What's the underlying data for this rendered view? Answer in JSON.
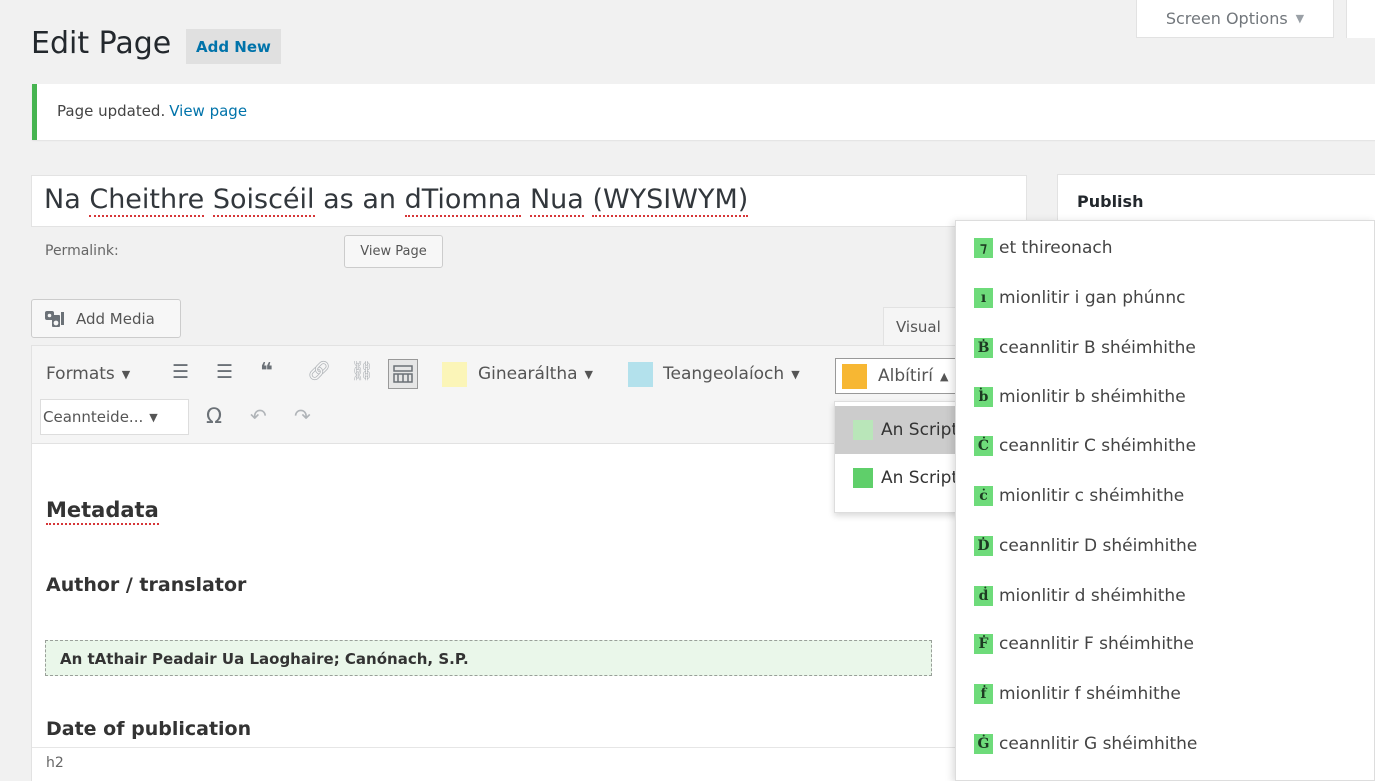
{
  "header": {
    "screen_options_label": "Screen Options",
    "title": "Edit Page",
    "add_new_label": "Add New"
  },
  "notice": {
    "text": "Page updated.",
    "link_label": "View page",
    "accent_color": "#46b450"
  },
  "post": {
    "title_words": [
      "Na",
      "Cheithre",
      "Soiscéil",
      "as",
      "an",
      "dTiomna",
      "Nua",
      "(WYSIWYM)"
    ],
    "permalink_label": "Permalink:",
    "view_page_button": "View Page"
  },
  "media": {
    "add_media_label": "Add Media",
    "visual_tab_label": "Visual"
  },
  "toolbar": {
    "formats_label": "Formats",
    "generic_label": "Ginearáltha",
    "linguistic_label": "Teangeolaíoch",
    "alphabet_label": "Albítirí",
    "headings_label": "Ceannteide...",
    "omega_glyph": "Ω",
    "swatch_generic_color": "#fbf5b8",
    "swatch_linguistic_color": "#b3e1ec",
    "swatch_alphabet_color": "#f7b733",
    "icons": [
      "bullet-list-icon",
      "numbered-list-icon",
      "blockquote-icon",
      "link-icon",
      "unlink-icon",
      "toolbar-toggle-icon",
      "special-character-icon",
      "undo-icon",
      "redo-icon"
    ]
  },
  "alphabet_submenu": {
    "items": [
      {
        "label": "An Script",
        "color": "#b9e6b9"
      },
      {
        "label": "An Script",
        "color": "#5fcf6a"
      }
    ]
  },
  "content": {
    "heading_metadata": "Metadata",
    "heading_author": "Author / translator",
    "author_value": "An tAthair Peadair Ua Laoghaire; Canónach, S.P.",
    "heading_date": "Date of publication",
    "status_path": "h2"
  },
  "publish": {
    "title": "Publish"
  },
  "character_menu": {
    "items": [
      {
        "glyph": "⁊",
        "label": "et thireonach"
      },
      {
        "glyph": "ı",
        "label": "mionlitir i gan phúnnc"
      },
      {
        "glyph": "Ḃ",
        "label": "ceannlitir B shéimhithe"
      },
      {
        "glyph": "ḃ",
        "label": "mionlitir b shéimhithe"
      },
      {
        "glyph": "Ċ",
        "label": "ceannlitir C shéimhithe"
      },
      {
        "glyph": "ċ",
        "label": "mionlitir c shéimhithe"
      },
      {
        "glyph": "Ḋ",
        "label": "ceannlitir D shéimhithe"
      },
      {
        "glyph": "ḋ",
        "label": "mionlitir d shéimhithe"
      },
      {
        "glyph": "Ḟ",
        "label": "ceannlitir F shéimhithe"
      },
      {
        "glyph": "ḟ",
        "label": "mionlitir f shéimhithe"
      },
      {
        "glyph": "Ġ",
        "label": "ceannlitir G shéimhithe"
      }
    ]
  }
}
